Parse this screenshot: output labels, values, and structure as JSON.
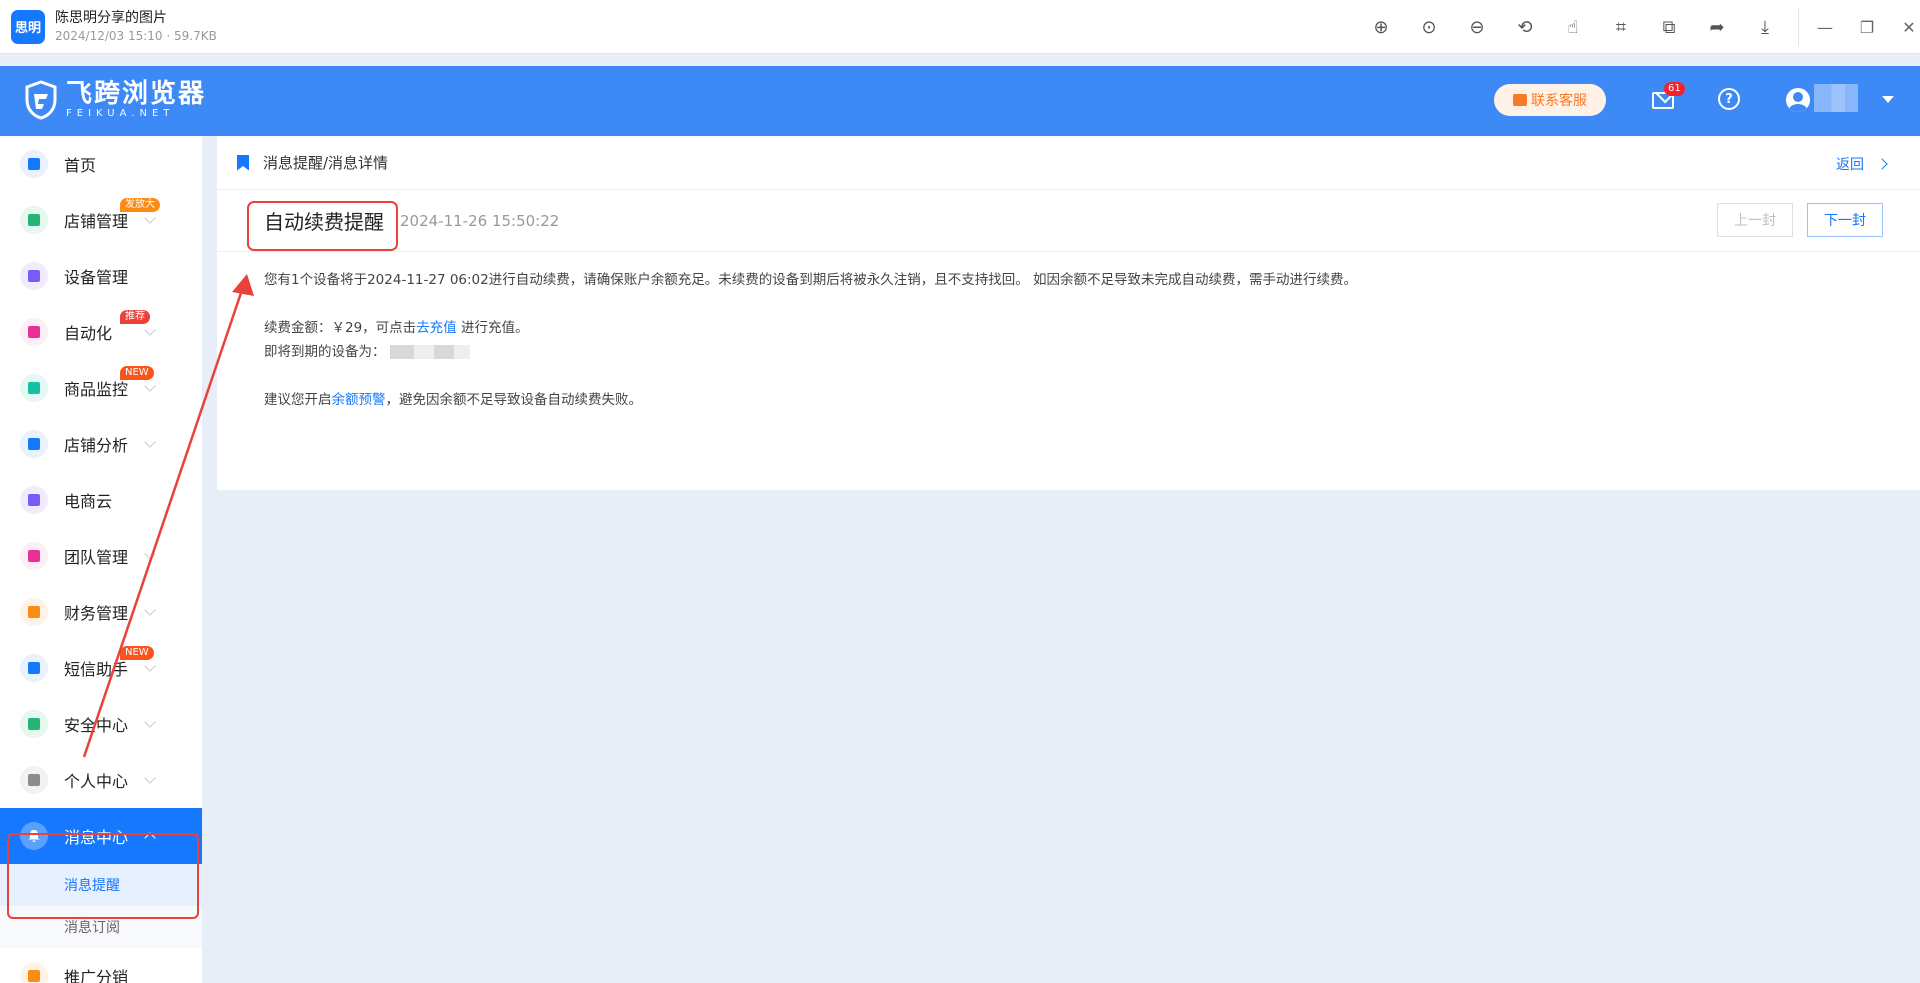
{
  "viewer": {
    "logo_text": "思明",
    "title": "陈思明分享的图片",
    "subtitle": "2024/12/03 15:10 · 59.7KB",
    "tools": [
      "zoom-in",
      "fit",
      "zoom-out",
      "rotate",
      "hand",
      "crop",
      "copy",
      "share",
      "download"
    ],
    "window": [
      "minimize",
      "restore",
      "close"
    ]
  },
  "header": {
    "brand_name": "飞跨浏览器",
    "brand_url": "FEIKUA.NET",
    "customer_service": "联系客服",
    "mail_count": "61",
    "help": "?"
  },
  "sidebar": {
    "items": [
      {
        "label": "首页",
        "icon": "home-icon",
        "color": "#1677ff",
        "bg": "#eaf2ff"
      },
      {
        "label": "店铺管理",
        "icon": "store-icon",
        "color": "#22b573",
        "bg": "#e6f8ef",
        "badge": "发放大",
        "badge_color": "#fa8c16"
      },
      {
        "label": "设备管理",
        "icon": "device-icon",
        "color": "#7a5af8",
        "bg": "#f0ecfe"
      },
      {
        "label": "自动化",
        "icon": "robot-icon",
        "color": "#eb2f96",
        "bg": "#fdeef6",
        "badge": "推荐",
        "badge_color": "#e8423a"
      },
      {
        "label": "商品监控",
        "icon": "monitor-icon",
        "color": "#13c2a3",
        "bg": "#e6f8f4",
        "badge": "NEW",
        "badge_color": "#fa541c"
      },
      {
        "label": "店铺分析",
        "icon": "analysis-icon",
        "color": "#1677ff",
        "bg": "#eaf2ff"
      },
      {
        "label": "电商云",
        "icon": "cloud-icon",
        "color": "#7a5af8",
        "bg": "#f0ecfe"
      },
      {
        "label": "团队管理",
        "icon": "team-icon",
        "color": "#eb2f96",
        "bg": "#fdeef6"
      },
      {
        "label": "财务管理",
        "icon": "wallet-icon",
        "color": "#fa8c16",
        "bg": "#fff3e6"
      },
      {
        "label": "短信助手",
        "icon": "sms-icon",
        "color": "#1677ff",
        "bg": "#eaf2ff",
        "badge": "NEW",
        "badge_color": "#fa541c"
      },
      {
        "label": "安全中心",
        "icon": "shield-icon",
        "color": "#22b573",
        "bg": "#e6f8ef"
      },
      {
        "label": "个人中心",
        "icon": "person-icon",
        "color": "#8c8c8c",
        "bg": "#f2f2f2"
      }
    ],
    "active": {
      "label": "消息中心",
      "icon": "bell-icon"
    },
    "sub_items": [
      {
        "label": "消息提醒"
      },
      {
        "label": "消息订阅"
      }
    ],
    "next_partial": "推广分销"
  },
  "content": {
    "breadcrumb": "消息提醒/消息详情",
    "back": "返回",
    "title": "自动续费提醒",
    "time": "2024-11-26 15:50:22",
    "prev": "上一封",
    "next": "下一封",
    "line1": "您有1个设备将于2024-11-27 06:02进行自动续费，请确保账户余额充足。未续费的设备到期后将被永久注销，且不支持找回。 如因余额不足导致未完成自动续费，需手动进行续费。",
    "amount_prefix": "续费金额：￥29，可点击",
    "recharge_link": "去充值",
    "amount_suffix": " 进行充值。",
    "expiring_label": "即将到期的设备为：",
    "suggest_prefix": "建议您开启",
    "alert_link": "余额预警",
    "suggest_suffix": "，避免因余额不足导致设备自动续费失败。"
  },
  "colors": {
    "primary": "#1677ff",
    "header": "#3d8af7",
    "annotation": "#e8423a"
  }
}
